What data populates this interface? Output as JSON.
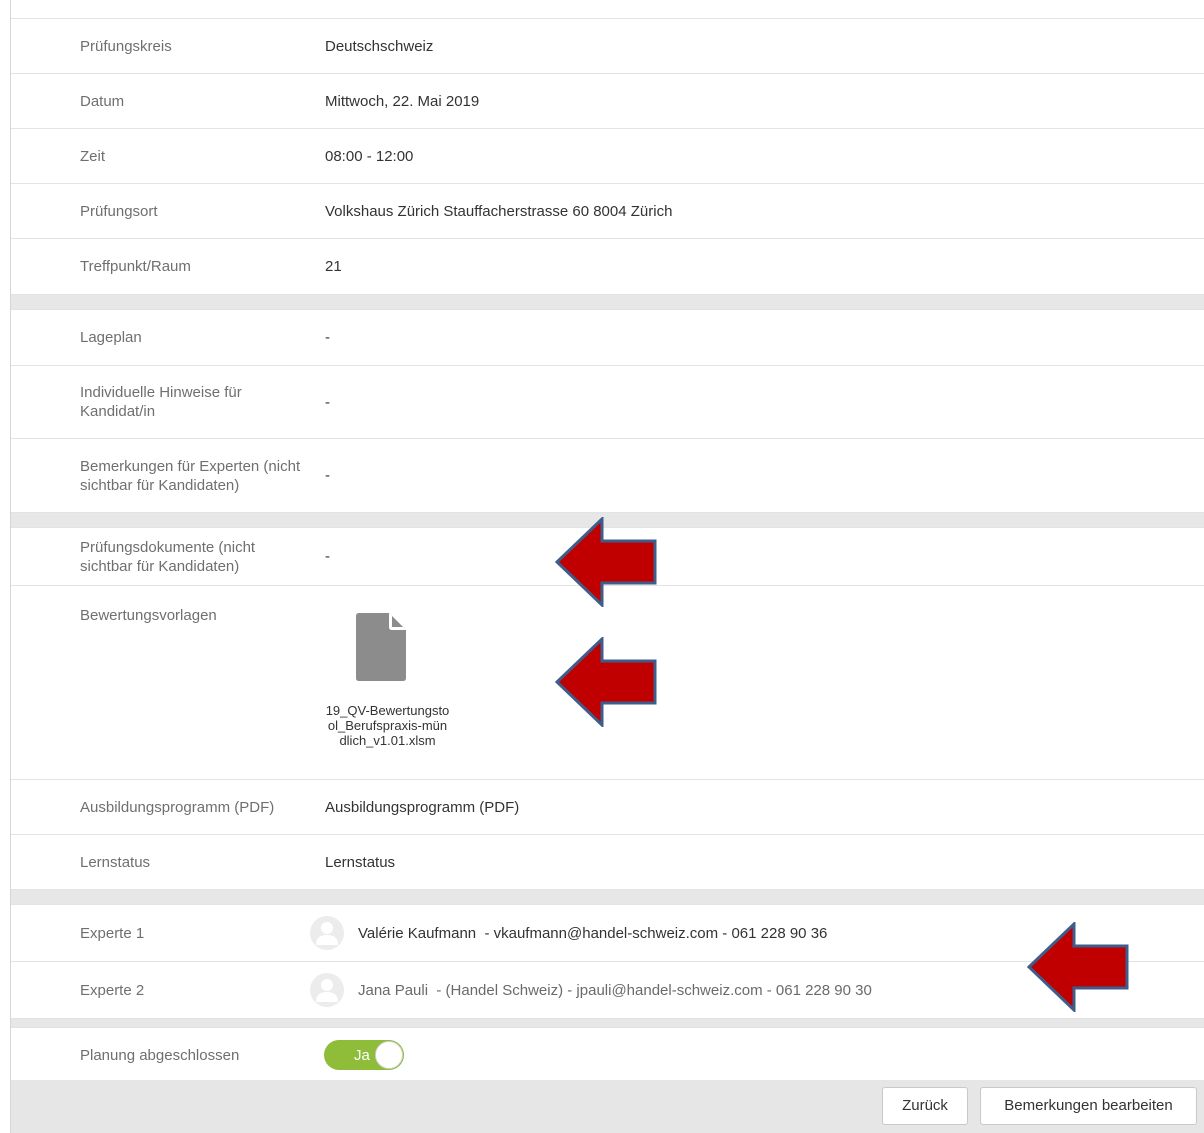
{
  "rows_top": [
    {
      "label": "Prüfungskreis",
      "value": "Deutschschweiz"
    },
    {
      "label": "Datum",
      "value": "Mittwoch, 22. Mai 2019"
    },
    {
      "label": "Zeit",
      "value": "08:00 - 12:00"
    },
    {
      "label": "Prüfungsort",
      "value": "Volkshaus Zürich Stauffacherstrasse 60 8004 Zürich"
    },
    {
      "label": "Treffpunkt/Raum",
      "value": "21"
    }
  ],
  "rows_mid": [
    {
      "label": "Lageplan",
      "value": "-"
    },
    {
      "label": "Individuelle Hinweise für Kandidat/in",
      "value": "-"
    },
    {
      "label": "Bemerkungen für Experten (nicht sichtbar für Kandidaten)",
      "value": "-"
    }
  ],
  "documents": {
    "exam_docs_label": "Prüfungsdokumente (nicht sichtbar für Kandidaten)",
    "exam_docs_value": "-",
    "templates_label": "Bewertungsvorlagen",
    "template_file": "19_QV-Bewertungstool_Berufspraxis-mündlich_v1.01.xlsm",
    "file_icon": "file-icon",
    "training_label": "Ausbildungsprogramm (PDF)",
    "training_link": "Ausbildungsprogramm (PDF)",
    "status_label": "Lernstatus",
    "status_link": "Lernstatus"
  },
  "experts": [
    {
      "label": "Experte 1",
      "value": "Valérie Kaufmann  - vkaufmann@handel-schweiz.com - 061 228 90 36",
      "avatar": "user-avatar-icon"
    },
    {
      "label": "Experte 2",
      "value": "Jana Pauli  - (Handel Schweiz) - jpauli@handel-schweiz.com - 061 228 90 30",
      "avatar": "user-avatar-icon"
    }
  ],
  "planning": {
    "label": "Planung abgeschlossen",
    "toggle_text": "Ja",
    "toggle_state": "on"
  },
  "footer": {
    "back_label": "Zurück",
    "edit_label": "Bemerkungen bearbeiten"
  },
  "colors": {
    "link": "#e09a3c",
    "toggle_on": "#8fbd3a",
    "annotation_arrow": "#c00000",
    "annotation_arrow_border": "#3f5d8a"
  }
}
